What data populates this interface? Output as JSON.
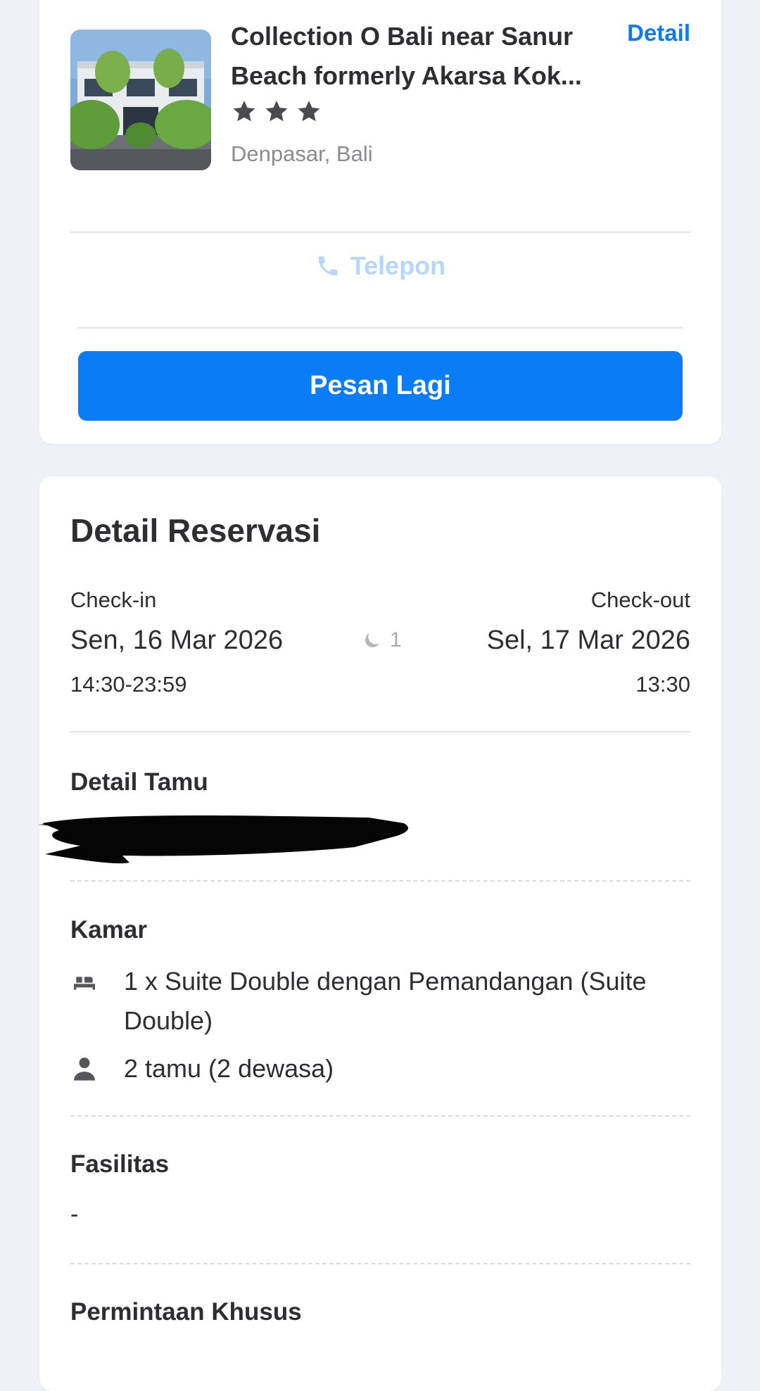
{
  "hotel": {
    "name": "Collection O Bali near Sanur Beach formerly Akarsa Kok...",
    "detail_label": "Detail",
    "star_count": 3,
    "location": "Denpasar, Bali",
    "phone_label": "Telepon",
    "rebook_label": "Pesan Lagi"
  },
  "reservation": {
    "title": "Detail Reservasi",
    "checkin_label": "Check-in",
    "checkin_date": "Sen, 16 Mar 2026",
    "checkin_time": "14:30-23:59",
    "nights": "1",
    "checkout_label": "Check-out",
    "checkout_date": "Sel, 17 Mar 2026",
    "checkout_time": "13:30",
    "guest_title": "Detail Tamu",
    "room_title": "Kamar",
    "room_desc": "1 x Suite Double dengan Pemandangan (Suite Double)",
    "guest_count": "2 tamu (2 dewasa)",
    "facilities_title": "Fasilitas",
    "facilities_value": "-",
    "special_request_title": "Permintaan Khusus"
  },
  "colors": {
    "accent": "#0a7cf5",
    "link": "#0a7cf0",
    "phone_disabled": "#b6d6fb",
    "background": "#eef1f8"
  },
  "icons": [
    "hotel-photo",
    "star-icon",
    "phone-icon",
    "moon-icon",
    "bed-icon",
    "person-icon"
  ]
}
